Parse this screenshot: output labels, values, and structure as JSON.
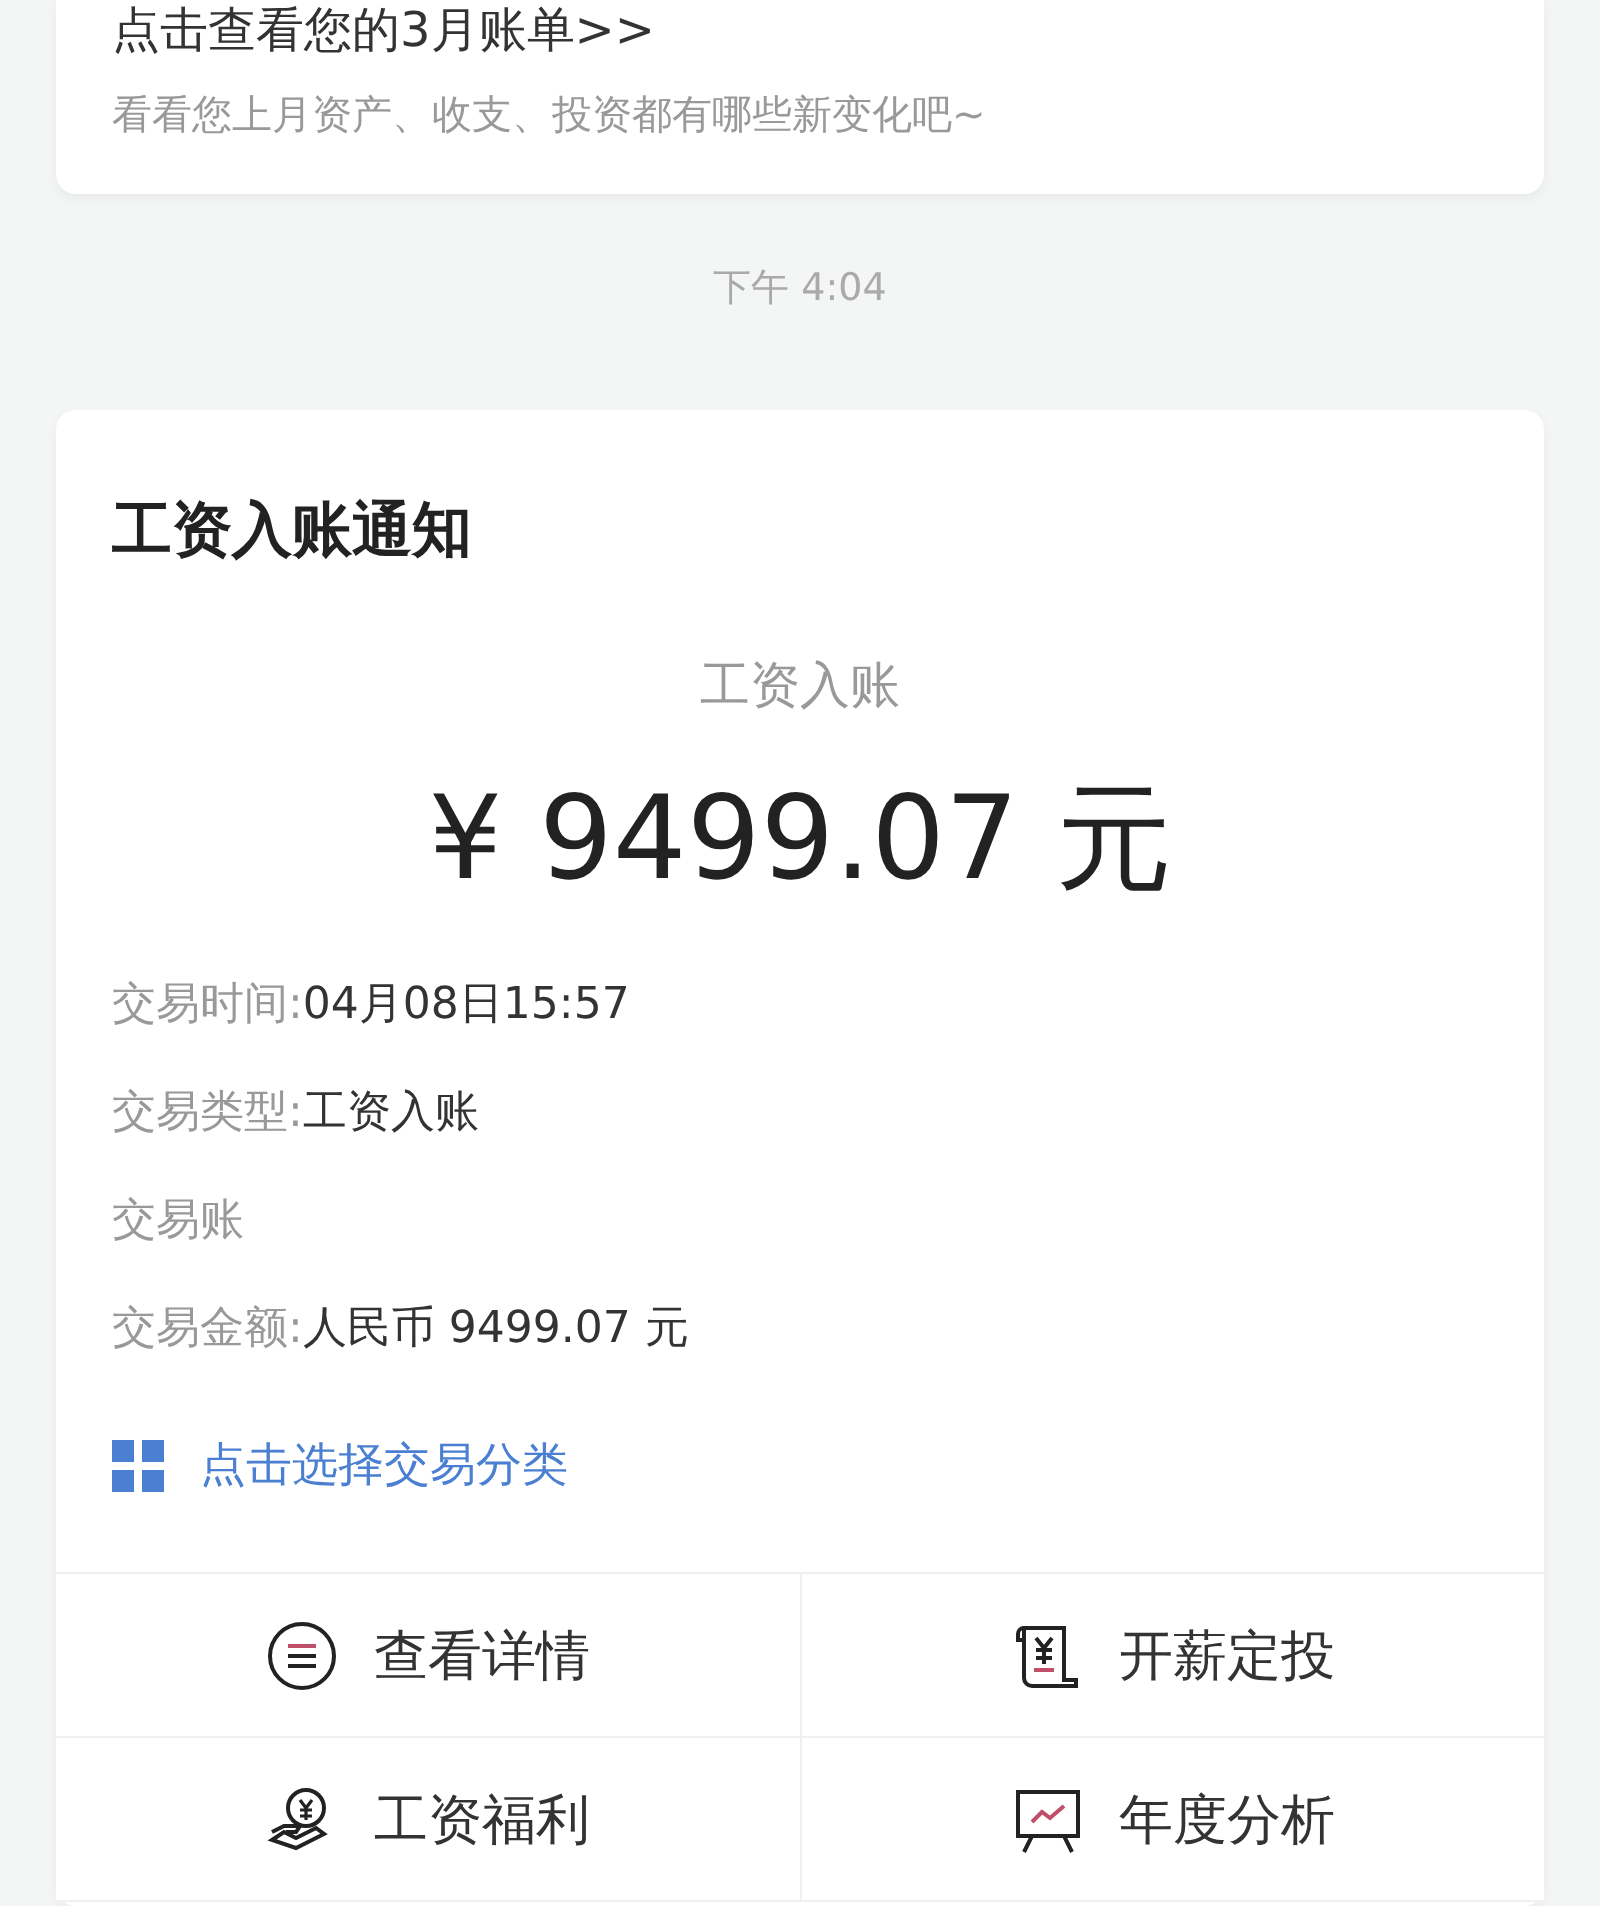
{
  "bill_card": {
    "title": "点击查看您的3月账单>>",
    "subtitle": "看看您上月资产、收支、投资都有哪些新变化吧~"
  },
  "timestamp": "下午 4:04",
  "salary_card": {
    "title": "工资入账通知",
    "caption": "工资入账",
    "amount": "¥ 9499.07 元",
    "details": [
      {
        "label": "交易时间:",
        "value": "04月08日15:57"
      },
      {
        "label": "交易类型:",
        "value": "工资入账"
      },
      {
        "label": "交易账"
      },
      {
        "label": "交易金额:",
        "value": "人民币 9499.07 元"
      }
    ],
    "category_link": "点击选择交易分类",
    "actions": [
      {
        "kind": "details",
        "label": "查看详情"
      },
      {
        "kind": "invest",
        "label": "开薪定投"
      },
      {
        "kind": "benefits",
        "label": "工资福利"
      },
      {
        "kind": "analysis",
        "label": "年度分析"
      }
    ]
  }
}
